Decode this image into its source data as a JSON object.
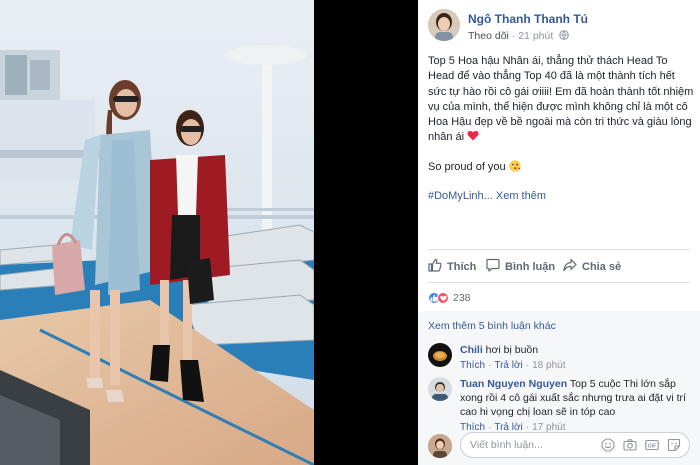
{
  "post": {
    "author_name": "Ngô Thanh Thanh Tú",
    "follow_label": "Theo dõi",
    "time": "21 phút",
    "paragraph1": "Top 5 Hoa hậu Nhân ái, thẳng thử thách Head To Head để vào thẳng Top 40 đã là một thành tích hết sức tự hào rồi cô gái ơiiii! Em đã hoàn thành tốt nhiệm vụ của mình, thể hiện được mình không chỉ là một cô Hoa Hậu đẹp về bề ngoài mà còn tri thức và giàu lòng nhân ái",
    "paragraph2": "So proud of you",
    "hashtag": "#DoMyLinh...",
    "see_more": "Xem thêm"
  },
  "actions": {
    "like": "Thích",
    "comment": "Bình luận",
    "share": "Chia sẻ"
  },
  "reactions": {
    "count": "238"
  },
  "comments": {
    "view_more": "Xem thêm 5 bình luận khác",
    "items": [
      {
        "name": "Chili",
        "text": "hơi bị buồn",
        "like": "Thích",
        "reply": "Trả lời",
        "time": "18 phút"
      },
      {
        "name": "Tuan Nguyen Nguyen",
        "text": "Top 5 cuộc Thi lớn sắp xong rồi 4 cô gái xuất sắc nhưng trưa ai đặt vi trí cao hi vọng chị loan sẽ in tóp cao",
        "like": "Thích",
        "reply": "Trả lời",
        "time": "17 phút"
      }
    ],
    "composer_placeholder": "Viết bình luận..."
  },
  "colors": {
    "link_blue": "#365899",
    "like_blue": "#4080ff",
    "love_red": "#f25268",
    "muted": "#90949c"
  }
}
